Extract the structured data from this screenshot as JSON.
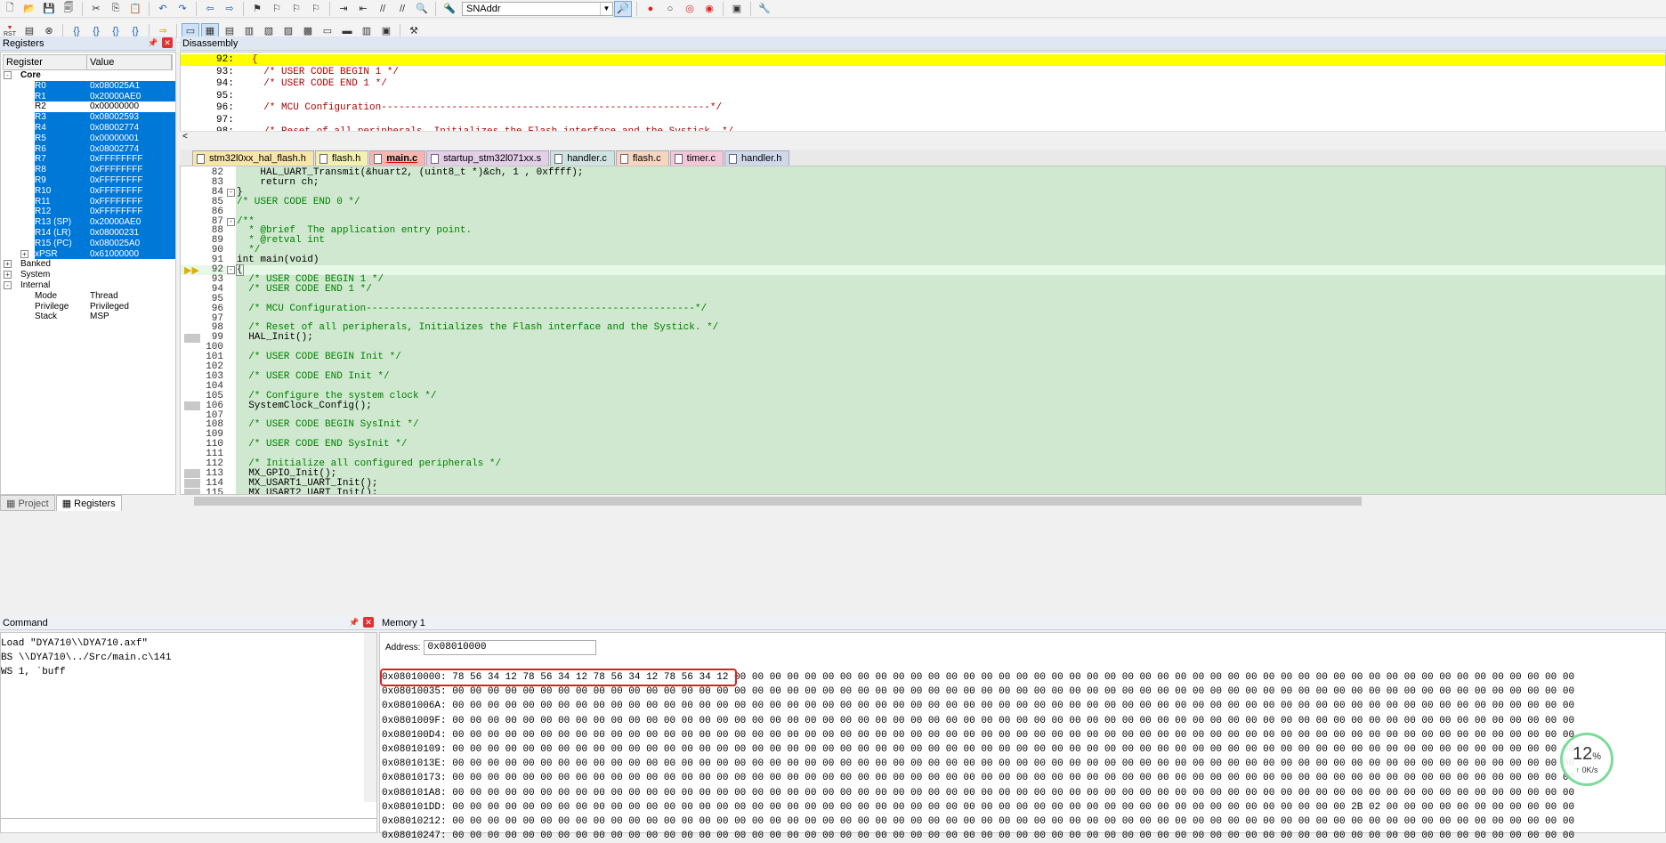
{
  "toolbar": {
    "target_combo": "SNAddr",
    "icons1": [
      "new-file-icon",
      "open-icon",
      "save-icon",
      "save-all-icon",
      "cut-icon",
      "copy-icon",
      "paste-icon",
      "undo-icon",
      "redo-icon",
      "nav-back-icon",
      "nav-forward-icon",
      "bookmark-icon",
      "bookmark-prev-icon",
      "bookmark-next-icon",
      "bookmark-clear-icon",
      "indent-icon",
      "unindent-icon",
      "comment-icon",
      "uncomment-icon",
      "find-in-files-icon"
    ],
    "icons1b": [
      "debug-session-icon",
      "breakpoint-insert-icon",
      "breakpoint-disable-icon",
      "breakpoint-kill-icon",
      "breakpoint-kill-all-icon",
      "window-layout-icon",
      "config-wrench-icon"
    ],
    "reset_label": "RST",
    "icons2": [
      "reset-icon",
      "run-icon",
      "stop-icon",
      "step-into-icon",
      "step-over-icon",
      "step-out-icon",
      "run-to-cursor-icon",
      "show-next-statement-icon",
      "command-window-icon",
      "disassembly-window-icon",
      "symbols-window-icon",
      "registers-window-icon",
      "call-stack-icon",
      "watch-window-icon",
      "memory-window-icon",
      "serial-window-icon",
      "analysis-window-icon",
      "trace-window-icon",
      "system-viewer-icon",
      "toolbox-icon"
    ]
  },
  "registers": {
    "title": "Registers",
    "col_register": "Register",
    "col_value": "Value",
    "core_label": "Core",
    "core": [
      {
        "name": "R0",
        "value": "0x080025A1",
        "selected": true
      },
      {
        "name": "R1",
        "value": "0x20000AE0",
        "selected": true
      },
      {
        "name": "R2",
        "value": "0x00000000",
        "selected": false
      },
      {
        "name": "R3",
        "value": "0x08002593",
        "selected": true
      },
      {
        "name": "R4",
        "value": "0x08002774",
        "selected": true
      },
      {
        "name": "R5",
        "value": "0x00000001",
        "selected": true
      },
      {
        "name": "R6",
        "value": "0x08002774",
        "selected": true
      },
      {
        "name": "R7",
        "value": "0xFFFFFFFF",
        "selected": true
      },
      {
        "name": "R8",
        "value": "0xFFFFFFFF",
        "selected": true
      },
      {
        "name": "R9",
        "value": "0xFFFFFFFF",
        "selected": true
      },
      {
        "name": "R10",
        "value": "0xFFFFFFFF",
        "selected": true
      },
      {
        "name": "R11",
        "value": "0xFFFFFFFF",
        "selected": true
      },
      {
        "name": "R12",
        "value": "0xFFFFFFFF",
        "selected": true
      },
      {
        "name": "R13 (SP)",
        "value": "0x20000AE0",
        "selected": true
      },
      {
        "name": "R14 (LR)",
        "value": "0x08000231",
        "selected": true
      },
      {
        "name": "R15 (PC)",
        "value": "0x080025A0",
        "selected": true
      },
      {
        "name": "xPSR",
        "value": "0x61000000",
        "selected": true
      }
    ],
    "banked_label": "Banked",
    "system_label": "System",
    "internal_label": "Internal",
    "internal": [
      {
        "name": "Mode",
        "value": "Thread"
      },
      {
        "name": "Privilege",
        "value": "Privileged"
      },
      {
        "name": "Stack",
        "value": "MSP"
      }
    ]
  },
  "left_tabs": {
    "project": "Project",
    "registers": "Registers"
  },
  "disassembly": {
    "title": "Disassembly",
    "lines": [
      {
        "ln": "92:",
        "text": "{"
      },
      {
        "ln": "93:",
        "text": "  /* USER CODE BEGIN 1 */"
      },
      {
        "ln": "94:",
        "text": "  /* USER CODE END 1 */"
      },
      {
        "ln": "95:",
        "text": ""
      },
      {
        "ln": "96:",
        "text": "  /* MCU Configuration--------------------------------------------------------*/"
      },
      {
        "ln": "97:",
        "text": ""
      },
      {
        "ln": "98:",
        "text": "  /* Reset of all peripherals, Initializes the Flash interface and the Systick. */"
      }
    ]
  },
  "file_tabs": [
    {
      "label": "stm32l0xx_hal_flash.h",
      "color": "#f7e6a8"
    },
    {
      "label": "flash.h",
      "color": "#f3f0b0"
    },
    {
      "label": "main.c",
      "color": "#f4b6b0",
      "active": true
    },
    {
      "label": "startup_stm32l071xx.s",
      "color": "#e3cfe8"
    },
    {
      "label": "handler.c",
      "color": "#cfe3e0"
    },
    {
      "label": "flash.c",
      "color": "#f7d6c0"
    },
    {
      "label": "timer.c",
      "color": "#f2c8d8"
    },
    {
      "label": "handler.h",
      "color": "#cfd9ea"
    }
  ],
  "editor": {
    "lines": [
      {
        "ln": "82",
        "t": "    HAL_UART_Transmit(&huart2, (uint8_t *)&ch, 1 , 0xffff);",
        "k": "code"
      },
      {
        "ln": "83",
        "t": "    return ch;",
        "k": "ret"
      },
      {
        "ln": "84",
        "t": "}",
        "k": "code"
      },
      {
        "ln": "85",
        "t": "/* USER CODE END 0 */",
        "k": "cm"
      },
      {
        "ln": "86",
        "t": "",
        "k": "code"
      },
      {
        "ln": "87",
        "t": "/**",
        "k": "cm"
      },
      {
        "ln": "88",
        "t": "  * @brief  The application entry point.",
        "k": "cm"
      },
      {
        "ln": "89",
        "t": "  * @retval int",
        "k": "cm"
      },
      {
        "ln": "90",
        "t": "  */",
        "k": "cm"
      },
      {
        "ln": "91",
        "t": "int main(void)",
        "k": "sig"
      },
      {
        "ln": "92",
        "t": "{",
        "k": "cur"
      },
      {
        "ln": "93",
        "t": "  /* USER CODE BEGIN 1 */",
        "k": "cm"
      },
      {
        "ln": "94",
        "t": "  /* USER CODE END 1 */",
        "k": "cm"
      },
      {
        "ln": "95",
        "t": "",
        "k": "code"
      },
      {
        "ln": "96",
        "t": "  /* MCU Configuration--------------------------------------------------------*/",
        "k": "cm"
      },
      {
        "ln": "97",
        "t": "",
        "k": "code"
      },
      {
        "ln": "98",
        "t": "  /* Reset of all peripherals, Initializes the Flash interface and the Systick. */",
        "k": "cm"
      },
      {
        "ln": "99",
        "t": "  HAL_Init();",
        "k": "code",
        "mark": true
      },
      {
        "ln": "100",
        "t": "",
        "k": "code"
      },
      {
        "ln": "101",
        "t": "  /* USER CODE BEGIN Init */",
        "k": "cm"
      },
      {
        "ln": "102",
        "t": "",
        "k": "code"
      },
      {
        "ln": "103",
        "t": "  /* USER CODE END Init */",
        "k": "cm"
      },
      {
        "ln": "104",
        "t": "",
        "k": "code"
      },
      {
        "ln": "105",
        "t": "  /* Configure the system clock */",
        "k": "cm"
      },
      {
        "ln": "106",
        "t": "  SystemClock_Config();",
        "k": "code",
        "mark": true
      },
      {
        "ln": "107",
        "t": "",
        "k": "code"
      },
      {
        "ln": "108",
        "t": "  /* USER CODE BEGIN SysInit */",
        "k": "cm"
      },
      {
        "ln": "109",
        "t": "",
        "k": "code"
      },
      {
        "ln": "110",
        "t": "  /* USER CODE END SysInit */",
        "k": "cm"
      },
      {
        "ln": "111",
        "t": "",
        "k": "code"
      },
      {
        "ln": "112",
        "t": "  /* Initialize all configured peripherals */",
        "k": "cm"
      },
      {
        "ln": "113",
        "t": "  MX_GPIO_Init();",
        "k": "code",
        "mark": true
      },
      {
        "ln": "114",
        "t": "  MX_USART1_UART_Init();",
        "k": "code",
        "mark": true
      },
      {
        "ln": "115",
        "t": "  MX_USART2_UART_Init();",
        "k": "code",
        "mark": true
      }
    ]
  },
  "command": {
    "title": "Command",
    "lines": [
      "Load \"DYA710\\\\DYA710.axf\"",
      "BS \\\\DYA710\\../Src/main.c\\141",
      "WS 1, `buff"
    ]
  },
  "memory": {
    "title": "Memory 1",
    "address_label": "Address:",
    "address_value": "0x08010000",
    "rows": [
      {
        "addr": "0x08010000:",
        "bytes": "78 56 34 12 78 56 34 12 78 56 34 12 78 56 34 12 00 00 00 00 00 00 00 00 00 00 00 00 00 00 00 00 00 00 00 00 00 00 00 00 00 00 00 00 00 00 00 00 00 00 00 00 00 00 00 00 00 00 00 00 00 00 00 00"
      },
      {
        "addr": "0x08010035:",
        "bytes": "00 00 00 00 00 00 00 00 00 00 00 00 00 00 00 00 00 00 00 00 00 00 00 00 00 00 00 00 00 00 00 00 00 00 00 00 00 00 00 00 00 00 00 00 00 00 00 00 00 00 00 00 00 00 00 00 00 00 00 00 00 00 00 00"
      },
      {
        "addr": "0x0801006A:",
        "bytes": "00 00 00 00 00 00 00 00 00 00 00 00 00 00 00 00 00 00 00 00 00 00 00 00 00 00 00 00 00 00 00 00 00 00 00 00 00 00 00 00 00 00 00 00 00 00 00 00 00 00 00 00 00 00 00 00 00 00 00 00 00 00 00 00"
      },
      {
        "addr": "0x0801009F:",
        "bytes": "00 00 00 00 00 00 00 00 00 00 00 00 00 00 00 00 00 00 00 00 00 00 00 00 00 00 00 00 00 00 00 00 00 00 00 00 00 00 00 00 00 00 00 00 00 00 00 00 00 00 00 00 00 00 00 00 00 00 00 00 00 00 00 00"
      },
      {
        "addr": "0x080100D4:",
        "bytes": "00 00 00 00 00 00 00 00 00 00 00 00 00 00 00 00 00 00 00 00 00 00 00 00 00 00 00 00 00 00 00 00 00 00 00 00 00 00 00 00 00 00 00 00 00 00 00 00 00 00 00 00 00 00 00 00 00 00 00 00 00 00 00 00"
      },
      {
        "addr": "0x08010109:",
        "bytes": "00 00 00 00 00 00 00 00 00 00 00 00 00 00 00 00 00 00 00 00 00 00 00 00 00 00 00 00 00 00 00 00 00 00 00 00 00 00 00 00 00 00 00 00 00 00 00 00 00 00 00 00 00 00 00 00 00 00 00 00 00 00 00 00"
      },
      {
        "addr": "0x0801013E:",
        "bytes": "00 00 00 00 00 00 00 00 00 00 00 00 00 00 00 00 00 00 00 00 00 00 00 00 00 00 00 00 00 00 00 00 00 00 00 00 00 00 00 00 00 00 00 00 00 00 00 00 00 00 00 00 00 00 00 00 00 00 00 00 00 00 00 00"
      },
      {
        "addr": "0x08010173:",
        "bytes": "00 00 00 00 00 00 00 00 00 00 00 00 00 00 00 00 00 00 00 00 00 00 00 00 00 00 00 00 00 00 00 00 00 00 00 00 00 00 00 00 00 00 00 00 00 00 00 00 00 00 00 00 00 00 00 00 00 00 00 00 00 00 00 00"
      },
      {
        "addr": "0x080101A8:",
        "bytes": "00 00 00 00 00 00 00 00 00 00 00 00 00 00 00 00 00 00 00 00 00 00 00 00 00 00 00 00 00 00 00 00 00 00 00 00 00 00 00 00 00 00 00 00 00 00 00 00 00 00 00 00 00 00 00 00 00 00 00 00 00 00 00 00"
      },
      {
        "addr": "0x080101DD:",
        "bytes": "00 00 00 00 00 00 00 00 00 00 00 00 00 00 00 00 00 00 00 00 00 00 00 00 00 00 00 00 00 00 00 00 00 00 00 00 00 00 00 00 00 00 00 00 00 00 00 00 00 00 00 2B 02 00 00 00 00 00 00 00 00 00 00 00"
      },
      {
        "addr": "0x08010212:",
        "bytes": "00 00 00 00 00 00 00 00 00 00 00 00 00 00 00 00 00 00 00 00 00 00 00 00 00 00 00 00 00 00 00 00 00 00 00 00 00 00 00 00 00 00 00 00 00 00 00 00 00 00 00 00 00 00 00 00 00 00 00 00 00 00 00 00"
      },
      {
        "addr": "0x08010247:",
        "bytes": "00 00 00 00 00 00 00 00 00 00 00 00 00 00 00 00 00 00 00 00 00 00 00 00 00 00 00 00 00 00 00 00 00 00 00 00 00 00 00 00 00 00 00 00 00 00 00 00 00 00 00 00 00 00 00 00 00 00 00 00 00 00 00 00"
      }
    ]
  },
  "gauge": {
    "percent": "12",
    "unit": "%",
    "rate": "0K/s"
  },
  "colors": {
    "selection": "#0078d7",
    "editor_bg": "#cfe8cf",
    "current_line": "#ffff00",
    "highlight_box": "#e02020",
    "comment": "#008000",
    "keyword": "#0000ff"
  }
}
